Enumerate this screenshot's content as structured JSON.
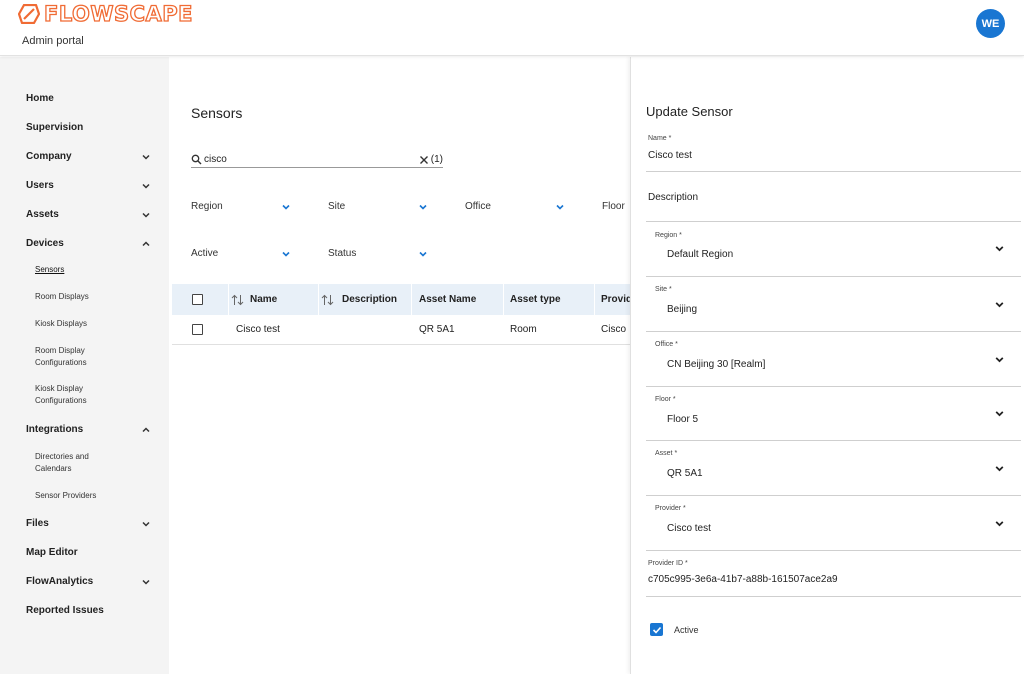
{
  "header": {
    "brand": "FLOWSCAPE",
    "subtitle": "Admin portal",
    "avatar_initials": "WE",
    "brand_color": "#f06b34",
    "accent_color": "#1976d2"
  },
  "sidebar": {
    "items": [
      {
        "label": "Home"
      },
      {
        "label": "Supervision"
      },
      {
        "label": "Company",
        "chevron": "down"
      },
      {
        "label": "Users",
        "chevron": "down"
      },
      {
        "label": "Assets",
        "chevron": "down"
      },
      {
        "label": "Devices",
        "chevron": "up"
      },
      {
        "label": "Integrations",
        "chevron": "up"
      },
      {
        "label": "Files",
        "chevron": "down"
      },
      {
        "label": "Map Editor"
      },
      {
        "label": "FlowAnalytics",
        "chevron": "down"
      },
      {
        "label": "Reported Issues"
      }
    ],
    "devices_sub": [
      {
        "label": "Sensors",
        "active": true
      },
      {
        "label": "Room Displays"
      },
      {
        "label": "Kiosk Displays"
      },
      {
        "label": "Room Display Configurations"
      },
      {
        "label": "Kiosk Display Configurations"
      }
    ],
    "integrations_sub": [
      {
        "label": "Directories and Calendars"
      },
      {
        "label": "Sensor Providers"
      }
    ]
  },
  "main": {
    "title": "Sensors",
    "search": {
      "value": "cisco",
      "count": "(1)"
    },
    "filters": [
      {
        "label": "Region"
      },
      {
        "label": "Site"
      },
      {
        "label": "Office"
      },
      {
        "label": "Floor"
      },
      {
        "label": "Active"
      },
      {
        "label": "Status"
      }
    ],
    "table": {
      "columns": [
        "Name",
        "Description",
        "Asset Name",
        "Asset type",
        "Provid"
      ],
      "rows": [
        {
          "name": "Cisco test",
          "description": "",
          "asset_name": "QR 5A1",
          "asset_type": "Room",
          "provider": "Cisco"
        }
      ]
    }
  },
  "panel": {
    "title": "Update Sensor",
    "fields": {
      "name": {
        "label": "Name *",
        "value": "Cisco test"
      },
      "description": {
        "label": "Description",
        "value": ""
      },
      "region": {
        "label": "Region *",
        "value": "Default Region"
      },
      "site": {
        "label": "Site *",
        "value": "Beijing"
      },
      "office": {
        "label": "Office *",
        "value": "CN Beijing 30 [Realm]"
      },
      "floor": {
        "label": "Floor *",
        "value": "Floor 5"
      },
      "asset": {
        "label": "Asset *",
        "value": "QR 5A1"
      },
      "provider": {
        "label": "Provider *",
        "value": "Cisco test"
      },
      "provider_id": {
        "label": "Provider ID *",
        "value": "c705c995-3e6a-41b7-a88b-161507ace2a9"
      }
    },
    "active_label": "Active",
    "active_checked": true
  }
}
